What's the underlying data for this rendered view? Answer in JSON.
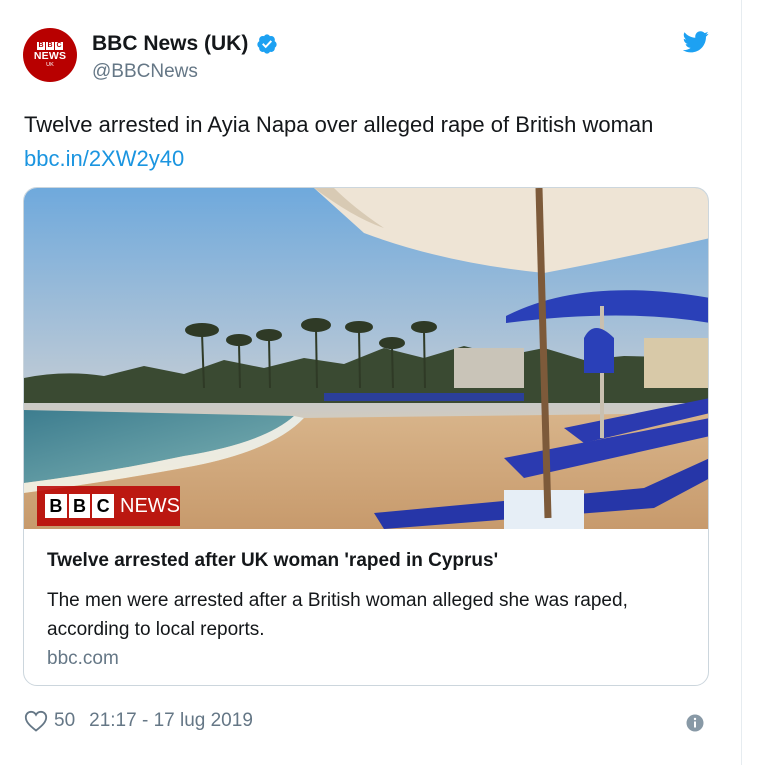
{
  "account": {
    "display_name": "BBC News (UK)",
    "handle": "@BBCNews",
    "verified": true,
    "avatar": {
      "blocks": [
        "B",
        "B",
        "C"
      ],
      "word": "NEWS",
      "region": "UK"
    }
  },
  "tweet": {
    "text": "Twelve arrested in Ayia Napa over alleged rape of British woman ",
    "link_text": "bbc.in/2XW2y40"
  },
  "card": {
    "image_alt": "beach-with-umbrellas-and-loungers",
    "image_logo": {
      "blocks": [
        "B",
        "B",
        "C"
      ],
      "word": "NEWS"
    },
    "title": "Twelve arrested after UK woman 'raped in Cyprus'",
    "description": "The men were arrested after a British woman alleged she was raped, according to local reports.",
    "domain": "bbc.com"
  },
  "footer": {
    "likes": "50",
    "timestamp": "21:17 - 17 lug 2019"
  },
  "icons": {
    "verified": "verified-badge-icon",
    "twitter": "twitter-bird-icon",
    "like": "heart-icon",
    "info": "info-icon"
  },
  "colors": {
    "brand_red": "#b80000",
    "link_blue": "#1b95e0",
    "secondary_text": "#657786",
    "twitter_blue": "#1da1f2"
  }
}
